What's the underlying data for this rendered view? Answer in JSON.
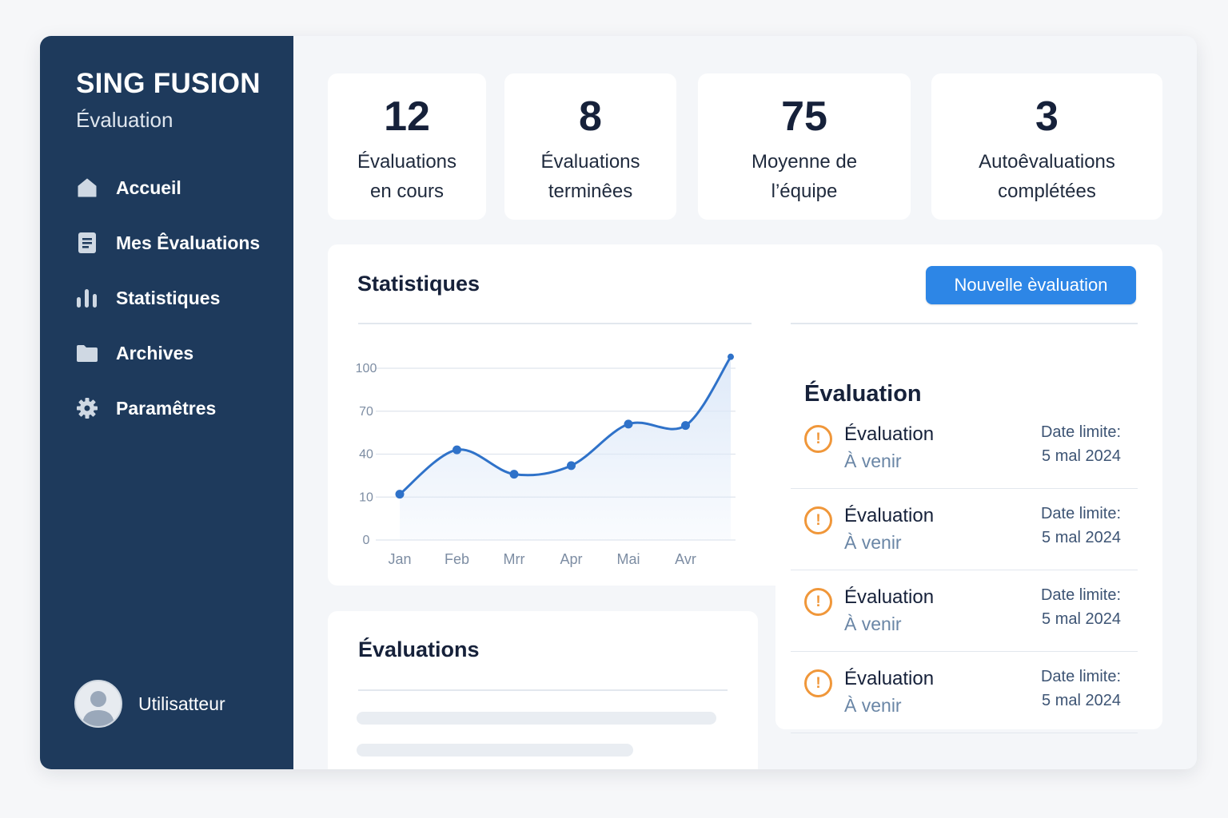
{
  "sidebar": {
    "brand_name": "SING FUSION",
    "brand_sub": "Évaluation",
    "items": [
      {
        "label": "Accueil",
        "icon": "home-icon"
      },
      {
        "label": "Mes Êvaluations",
        "icon": "document-icon"
      },
      {
        "label": "Statistiques",
        "icon": "bar-chart-icon"
      },
      {
        "label": "Archives",
        "icon": "folder-icon"
      },
      {
        "label": "Paramêtres",
        "icon": "gear-icon"
      }
    ],
    "user_name": "Utilisatteur"
  },
  "stats": [
    {
      "value": "12",
      "label": "Évaluations\nen cours"
    },
    {
      "value": "8",
      "label": "Évaluations\nterminêes"
    },
    {
      "value": "75",
      "label": "Moyenne de\nl’équipe"
    },
    {
      "value": "3",
      "label": "Autoêvaluations\ncomplétées"
    }
  ],
  "statistics_panel": {
    "title": "Statistiques",
    "new_button_label": "Nouvelle èvaluation"
  },
  "chart_data": {
    "type": "area",
    "categories": [
      "Jan",
      "Feb",
      "Mrr",
      "Apr",
      "Mai",
      "Avr"
    ],
    "values": [
      12,
      43,
      26,
      32,
      61,
      60,
      108
    ],
    "y_ticks": [
      0,
      10,
      40,
      70,
      100
    ],
    "title": "",
    "xlabel": "",
    "ylabel": "",
    "grid": true,
    "colors": {
      "line": "#2f72c9",
      "fill": "#dce8f8"
    }
  },
  "evaluation_list": {
    "title": "Évaluation",
    "items": [
      {
        "title": "Évaluation",
        "status": "À venir",
        "date_label": "Date limite:",
        "date": "5 mal 2024"
      },
      {
        "title": "Évaluation",
        "status": "À venir",
        "date_label": "Date limite:",
        "date": "5 mal 2024"
      },
      {
        "title": "Évaluation",
        "status": "À venir",
        "date_label": "Date limite:",
        "date": "5 mal 2024"
      },
      {
        "title": "Évaluation",
        "status": "À venir",
        "date_label": "Date limite:",
        "date": "5 mal 2024"
      }
    ]
  },
  "evaluations_panel": {
    "title": "Évaluations"
  },
  "colors": {
    "sidebar": "#1e3a5c",
    "accent": "#2d86e6",
    "warning": "#f0973a"
  }
}
